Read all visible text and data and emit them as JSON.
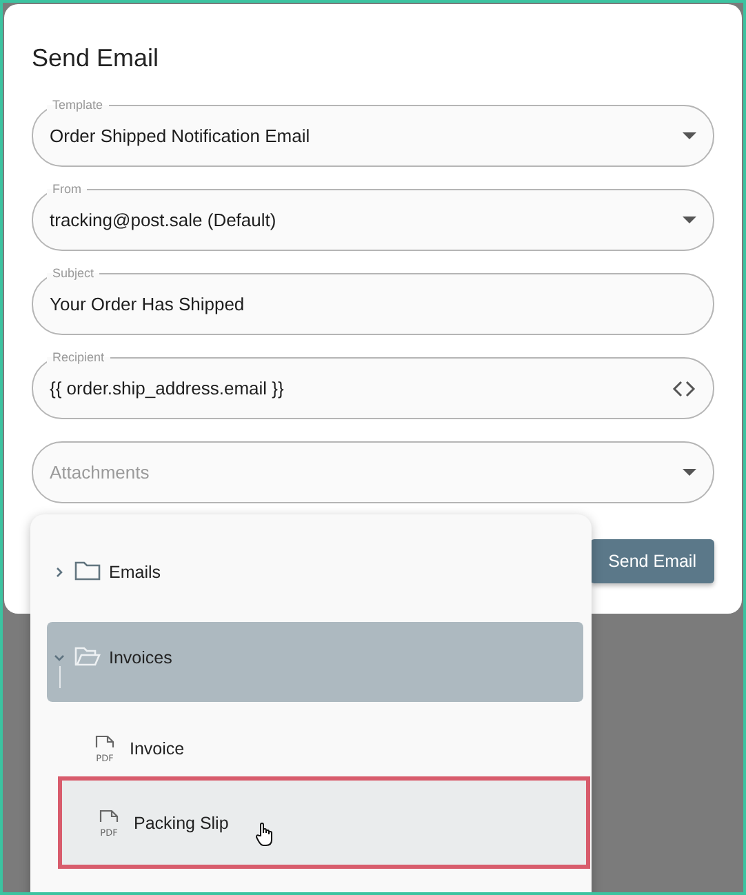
{
  "dialog": {
    "title": "Send Email",
    "fields": [
      {
        "kind": "select",
        "label": "Template",
        "value": "Order Shipped Notification Email"
      },
      {
        "kind": "select",
        "label": "From",
        "value": "tracking@post.sale (Default)"
      },
      {
        "kind": "text",
        "label": "Subject",
        "value": "Your Order Has Shipped"
      },
      {
        "kind": "code",
        "label": "Recipient",
        "value": "{{ order.ship_address.email }}"
      },
      {
        "kind": "select",
        "placeholder": "Attachments"
      }
    ],
    "buttons": [
      {
        "label": "Send Email"
      }
    ]
  },
  "attachments_menu": {
    "items": [
      {
        "kind": "folder",
        "label": "Emails",
        "expanded": false,
        "selected": false
      },
      {
        "kind": "folder",
        "label": "Invoices",
        "expanded": true,
        "selected": true,
        "children": [
          {
            "kind": "file",
            "label": "Invoice",
            "badge": "PDF",
            "hovered": false
          },
          {
            "kind": "file",
            "label": "Packing Slip",
            "badge": "PDF",
            "hovered": true
          }
        ]
      }
    ]
  }
}
